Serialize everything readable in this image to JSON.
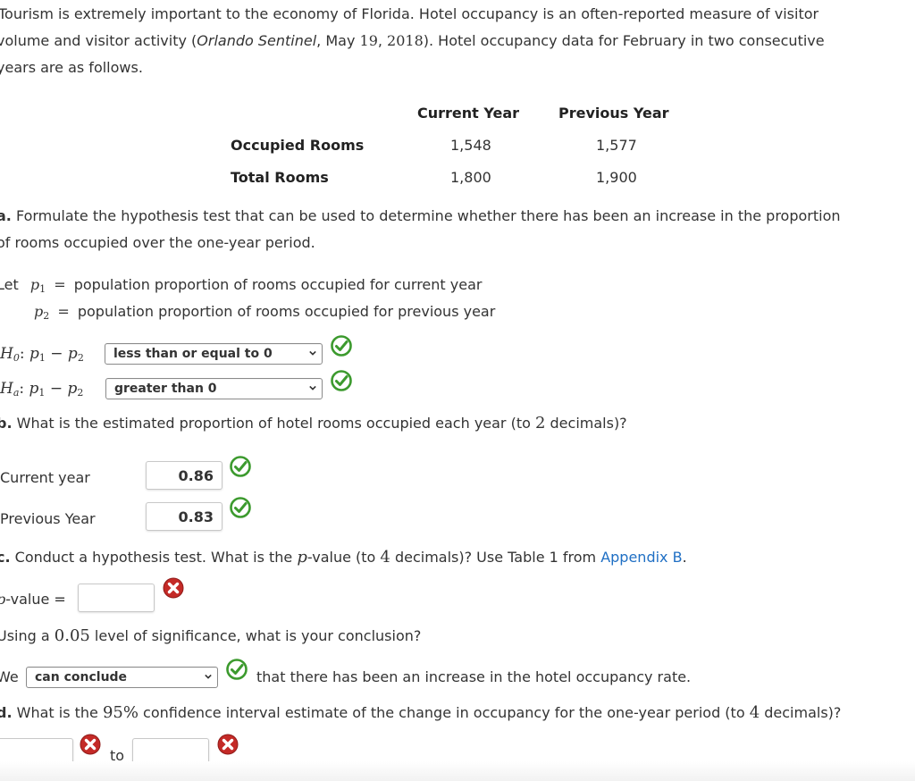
{
  "intro": {
    "line1": "Tourism is extremely important to the economy of Florida. Hotel occupancy is an often-reported measure of visitor",
    "line2_pre": "volume and visitor activity (",
    "line2_source": "Orlando Sentinel",
    "line2_mid": ", May ",
    "line2_day": "19",
    "line2_comma": ", ",
    "line2_year": "2018",
    "line2_post": "). Hotel occupancy data for February in two consecutive",
    "line3": "years are as follows."
  },
  "table": {
    "headers": [
      "Current Year",
      "Previous Year"
    ],
    "rows": [
      {
        "label": "Occupied Rooms",
        "values": [
          "1,548",
          "1,577"
        ]
      },
      {
        "label": "Total Rooms",
        "values": [
          "1,800",
          "1,900"
        ]
      }
    ]
  },
  "part_a": {
    "letter": "a.",
    "text1": " Formulate the hypothesis test that can be used to determine whether there has been an increase in the proportion",
    "text2": "of rooms occupied over the one-year period.",
    "let_label": "Let",
    "p": "p",
    "sub1": "1",
    "sub2": "2",
    "equals": "=",
    "p1_def": "population proportion of rooms occupied for current year",
    "p2_def": "population proportion of rooms occupied for previous year",
    "h0": {
      "H": "H",
      "sub": "0",
      "expr": ": ",
      "minus": "−",
      "selected": "less than or equal to 0",
      "status": "correct"
    },
    "ha": {
      "H": "H",
      "sub": "a",
      "expr": ": ",
      "minus": "−",
      "selected": "greater than 0",
      "status": "correct"
    }
  },
  "part_b": {
    "letter": "b.",
    "text_pre": " What is the estimated proportion of hotel rooms occupied each year (to ",
    "decimals": "2",
    "text_post": " decimals)?",
    "current_label": "Current year",
    "current_value": "0.86",
    "current_status": "correct",
    "previous_label": "Previous Year",
    "previous_value": "0.83",
    "previous_status": "correct"
  },
  "part_c": {
    "letter": "c.",
    "text_pre": " Conduct a hypothesis test. What is the ",
    "p": "p",
    "text_mid": "-value (to ",
    "decimals": "4",
    "text_post": " decimals)? Use Table 1 from ",
    "link": "Appendix B",
    "period": ".",
    "pvalue_label_p": "p",
    "pvalue_label": "-value =",
    "pvalue_value": "",
    "pvalue_status": "incorrect",
    "sig_pre": "Using a ",
    "sig_level": "0.05",
    "sig_post": " level of significance, what is your conclusion?",
    "we": "We",
    "conclusion_selected": "can conclude",
    "conclusion_status": "correct",
    "conclusion_post": "that there has been an increase in the hotel occupancy rate."
  },
  "part_d": {
    "letter": "d.",
    "text_pre": " What is the ",
    "conf": "95%",
    "text_mid": " confidence interval estimate of the change in occupancy for the one-year period (to ",
    "decimals": "4",
    "text_post": " decimals)?",
    "lower_value": "",
    "lower_status": "incorrect",
    "to": "to",
    "upper_value": "",
    "upper_status": "incorrect"
  },
  "colors": {
    "correct": "#3c9a2e",
    "incorrect": "#c42a27",
    "link": "#1f6fc4",
    "text": "#333333"
  }
}
